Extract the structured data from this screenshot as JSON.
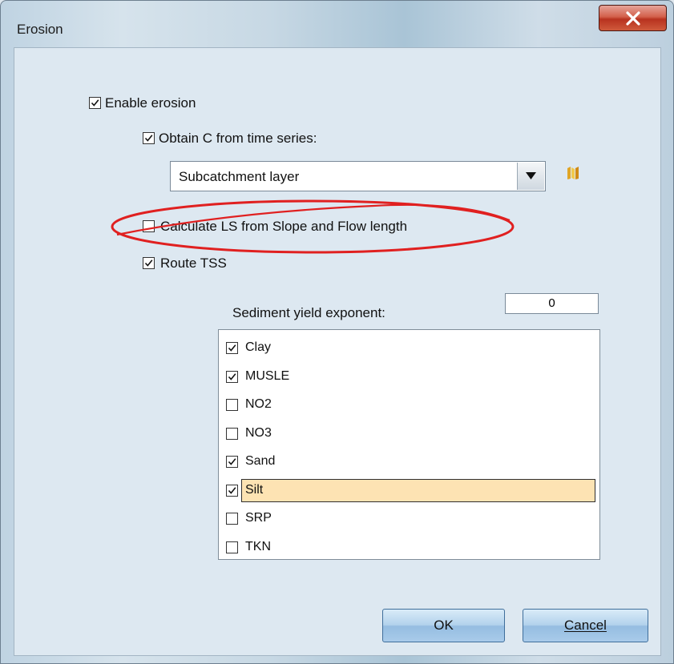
{
  "window": {
    "title": "Erosion"
  },
  "enable_erosion": {
    "label": "Enable erosion",
    "checked": true
  },
  "obtain_c": {
    "label": "Obtain C from time series:",
    "checked": true
  },
  "layer_combo": {
    "value": "Subcatchment layer"
  },
  "calc_ls": {
    "label": "Calculate LS from Slope and Flow length",
    "checked": false
  },
  "route_tss": {
    "label": "Route TSS",
    "checked": true
  },
  "sediment_yield": {
    "label": "Sediment yield exponent:",
    "value": "0"
  },
  "pollutants": [
    {
      "label": "Clay",
      "checked": true,
      "selected": false
    },
    {
      "label": "MUSLE",
      "checked": true,
      "selected": false
    },
    {
      "label": "NO2",
      "checked": false,
      "selected": false
    },
    {
      "label": "NO3",
      "checked": false,
      "selected": false
    },
    {
      "label": "Sand",
      "checked": true,
      "selected": false
    },
    {
      "label": "Silt",
      "checked": true,
      "selected": true
    },
    {
      "label": "SRP",
      "checked": false,
      "selected": false
    },
    {
      "label": "TKN",
      "checked": false,
      "selected": false
    }
  ],
  "buttons": {
    "ok": "OK",
    "cancel": "Cancel"
  },
  "colors": {
    "annotation": "#e02020",
    "selection": "#fde3b3",
    "close": "#c8442f"
  }
}
